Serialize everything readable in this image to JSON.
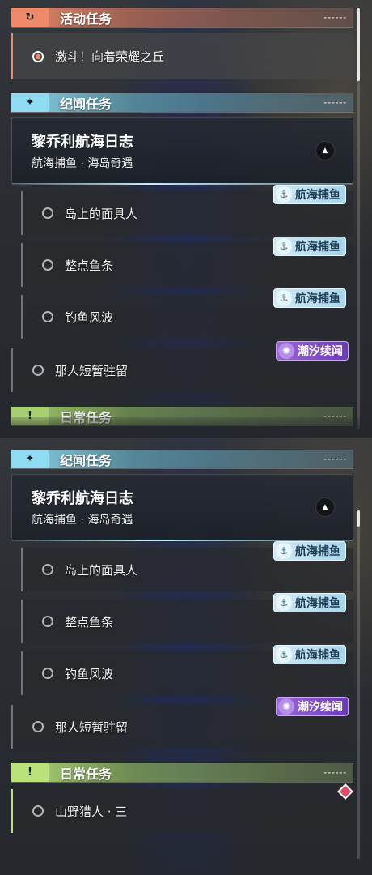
{
  "sections": {
    "activity": "活动任务",
    "lore": "纪闻任务",
    "daily": "日常任务"
  },
  "quests": {
    "activity_main": "激斗！向着荣耀之丘",
    "lore_title": "黎乔利航海日志",
    "lore_subtitle": "航海捕鱼 · 海岛奇遇",
    "q1": "岛上的面具人",
    "q2": "整点鱼条",
    "q3": "钓鱼风波",
    "q4": "那人短暂驻留",
    "daily_1": "山野猎人 · 三"
  },
  "badges": {
    "fishing": "航海捕鱼",
    "tide": "潮汐续闻"
  },
  "icons": {
    "activity": "refresh-arrow-icon",
    "lore": "sparkle-icon",
    "daily": "exclamation-icon",
    "collapse": "chevron-up-icon",
    "tracked": "red-diamond-marker-icon"
  },
  "colors": {
    "activity": "#ee8a6a",
    "lore": "#8fdcf2",
    "daily": "#b7e37a",
    "tide_badge": "#7a48c4",
    "fish_badge": "#bfe1f0"
  }
}
